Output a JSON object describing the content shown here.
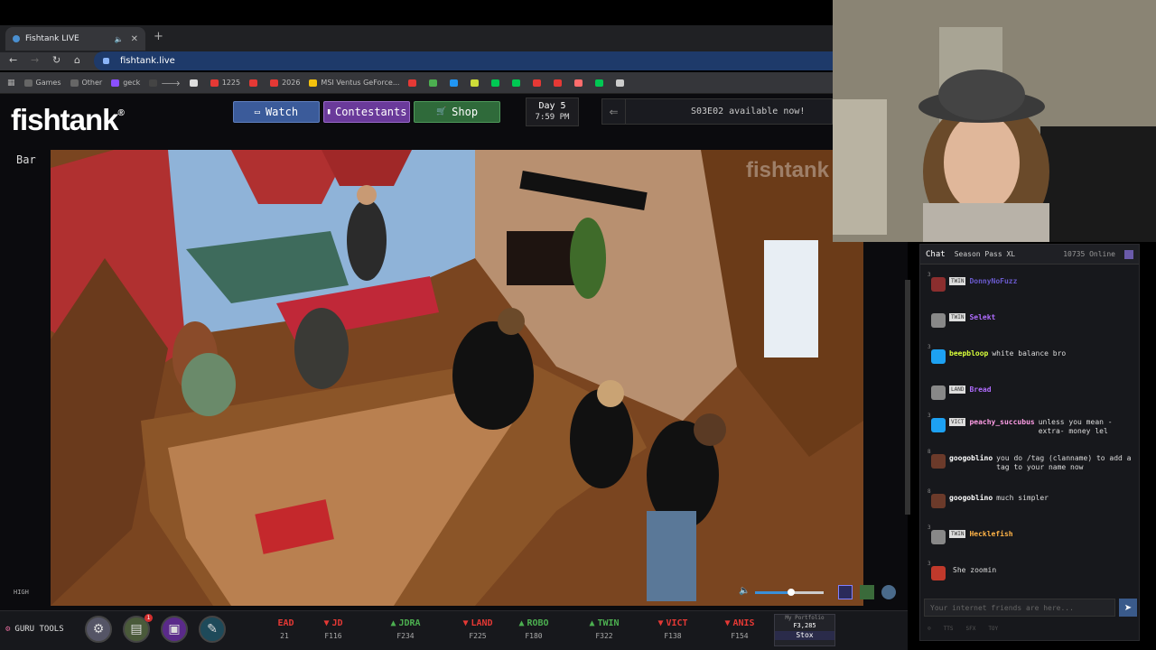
{
  "browser": {
    "tab_title": "Fishtank LIVE",
    "url": "fishtank.live",
    "bookmarks": [
      {
        "label": "Games",
        "color": "#666"
      },
      {
        "label": "Other",
        "color": "#666"
      },
      {
        "label": "geck",
        "color": "#8a4fff"
      },
      {
        "label": "🡒",
        "color": "#444"
      },
      {
        "label": "",
        "color": "#ddd"
      },
      {
        "label": "1225",
        "color": "#e53935"
      },
      {
        "label": "",
        "color": "#e53935"
      },
      {
        "label": "2026",
        "color": "#e53935"
      },
      {
        "label": "MSI Ventus GeForce...",
        "color": "#f4c20d"
      },
      {
        "label": "",
        "color": "#e53935"
      },
      {
        "label": "",
        "color": "#4caf50"
      },
      {
        "label": "",
        "color": "#2196f3"
      },
      {
        "label": "",
        "color": "#cddc39"
      },
      {
        "label": "",
        "color": "#00c853"
      },
      {
        "label": "",
        "color": "#00c853"
      },
      {
        "label": "",
        "color": "#e53935"
      },
      {
        "label": "",
        "color": "#e53935"
      },
      {
        "label": "",
        "color": "#ff6d6d"
      },
      {
        "label": "",
        "color": "#00c853"
      },
      {
        "label": "",
        "color": "#ccc"
      }
    ]
  },
  "site": {
    "logo": "fishtank",
    "logo_mark": "®",
    "nav": {
      "watch": "Watch",
      "contestants": "Contestants",
      "shop": "Shop"
    },
    "day": "Day 5",
    "time": "7:59 PM",
    "ticker": "S03E02 available now!",
    "room": "Bar",
    "quality": "HIGH",
    "watermark": "fishtank"
  },
  "chat": {
    "tab_chat": "Chat",
    "tab_pass": "Season Pass XL",
    "online": "10735 Online",
    "messages": [
      {
        "num": "3",
        "badge": "TWIN",
        "user": "DonnyNoFuzz",
        "text": "",
        "user_color": "#6a5acd",
        "av": "#8b2e2e"
      },
      {
        "num": "",
        "badge": "TWIN",
        "user": "Selekt",
        "text": "",
        "user_color": "#b06cff",
        "av": "#888"
      },
      {
        "num": "3",
        "badge": "",
        "user": "beepbloop",
        "text": "white balance bro",
        "user_color": "#d9ff3a",
        "av": "#1da1f2"
      },
      {
        "num": "",
        "badge": "LAND",
        "user": "Bread",
        "text": "",
        "user_color": "#b06cff",
        "av": "#888"
      },
      {
        "num": "3",
        "badge": "VICT",
        "user": "peachy_succubus",
        "text": "unless you mean -extra- money lel",
        "user_color": "#ff9de6",
        "av": "#1da1f2"
      },
      {
        "num": "8",
        "badge": "",
        "user": "googoblino",
        "text": "you do /tag (clanname) to add a tag to your name now",
        "user_color": "#fff",
        "av": "#6b3a2a"
      },
      {
        "num": "8",
        "badge": "",
        "user": "googoblino",
        "text": "much simpler",
        "user_color": "#fff",
        "av": "#6b3a2a"
      },
      {
        "num": "3",
        "badge": "TWIN",
        "user": "Hecklefish",
        "text": "",
        "user_color": "#ffb347",
        "av": "#888"
      },
      {
        "num": "3",
        "badge": "",
        "user": "",
        "text": "She zoomin",
        "user_color": "#e53935",
        "av": "#c0392b"
      }
    ],
    "placeholder": "Your internet friends are here...",
    "footer": [
      "TTS",
      "SFX",
      "TOY"
    ]
  },
  "bottom": {
    "guru": "GURU TOOLS",
    "notif": "1",
    "stocks": [
      {
        "name": "EAD",
        "price": "21",
        "dir": "",
        "color": "#e53935"
      },
      {
        "name": "JD",
        "price": "F116",
        "dir": "▼",
        "color": "#e53935"
      },
      {
        "name": "JDRA",
        "price": "F234",
        "dir": "▲",
        "color": "#4caf50"
      },
      {
        "name": "LAND",
        "price": "F225",
        "dir": "▼",
        "color": "#e53935"
      },
      {
        "name": "ROBO",
        "price": "F180",
        "dir": "▲",
        "color": "#4caf50"
      },
      {
        "name": "TWIN",
        "price": "F322",
        "dir": "▲",
        "color": "#4caf50"
      },
      {
        "name": "VICT",
        "price": "F138",
        "dir": "▼",
        "color": "#e53935"
      },
      {
        "name": "ANIS",
        "price": "F154",
        "dir": "▼",
        "color": "#e53935"
      }
    ],
    "portfolio_label": "My Portfolio",
    "portfolio_value": "F3,285",
    "stox": "Stox"
  }
}
